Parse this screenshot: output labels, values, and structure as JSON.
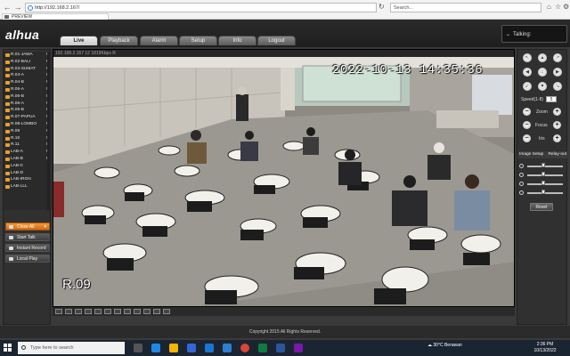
{
  "browser": {
    "url": "http://192.168.2.167/",
    "search_placeholder": "Search...",
    "tab_title": "PREVIEW"
  },
  "app": {
    "logo": "alhua",
    "nav_tabs": [
      "Live",
      "Playback",
      "Alarm",
      "Setup",
      "Info",
      "Logout"
    ],
    "active_tab": "Live",
    "talking_label": "Talking:"
  },
  "channels": [
    {
      "name": "R.01-JAWA",
      "status": "M"
    },
    {
      "name": "R.02-BALI",
      "status": "M"
    },
    {
      "name": "R.03-SUMAT",
      "status": "M"
    },
    {
      "name": "R.04-A",
      "status": "M"
    },
    {
      "name": "R.04-B",
      "status": "M"
    },
    {
      "name": "R.05-A",
      "status": "M"
    },
    {
      "name": "R.05-B",
      "status": "M"
    },
    {
      "name": "R.06-A",
      "status": "M"
    },
    {
      "name": "R.06-B",
      "status": "M"
    },
    {
      "name": "R.07-PAPUA",
      "status": "M"
    },
    {
      "name": "R.08-LOMBO",
      "status": "M"
    },
    {
      "name": "R.09",
      "status": "M"
    },
    {
      "name": "R.10",
      "status": "M"
    },
    {
      "name": "R.11",
      "status": "M"
    },
    {
      "name": "LAB-A",
      "status": "M"
    },
    {
      "name": "LAB-B",
      "status": "M"
    },
    {
      "name": "LAB-C",
      "status": ""
    },
    {
      "name": "LAB-D",
      "status": ""
    },
    {
      "name": "LAB-IRGN",
      "status": ""
    },
    {
      "name": "LAB-LLL",
      "status": ""
    }
  ],
  "side_buttons": {
    "close_all": "Close All",
    "start_talk": "Start Talk",
    "instant_record": "Instant Record",
    "local_play": "Local Play"
  },
  "video": {
    "stream_info": "192.168.2.167 12 1819Kbps R",
    "timestamp": "2022-10-13 14:35:36",
    "channel_osd": "R.09"
  },
  "ptz": {
    "speed_label": "Speed(1-8)",
    "speed_value": "5",
    "zoom_label": "Zoom",
    "focus_label": "Focus",
    "iris_label": "Iris"
  },
  "image_setup": {
    "title": "Image Setup",
    "relay_label": "Relay-out",
    "sliders": [
      {
        "icon": "brightness-icon",
        "level": 0.45
      },
      {
        "icon": "contrast-icon",
        "level": 0.45
      },
      {
        "icon": "saturation-icon",
        "level": 0.45
      },
      {
        "icon": "hue-icon",
        "level": 0.45
      }
    ],
    "reset_label": "Reset"
  },
  "footer": {
    "copyright": "Copyright 2015 All Rights Reserved."
  },
  "taskbar": {
    "search_placeholder": "Type here to search",
    "weather": "30°C Berawan",
    "time": "2:36 PM",
    "date": "10/13/2022"
  }
}
